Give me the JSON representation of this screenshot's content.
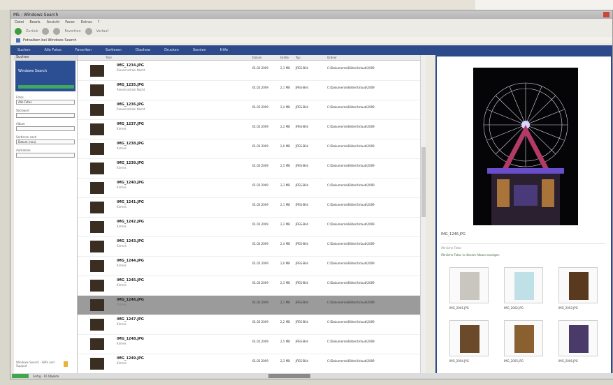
{
  "window": {
    "title": "MS - Windows Search",
    "menu": [
      "Datei",
      "Bearb.",
      "Ansicht",
      "Favor.",
      "Extras",
      "?"
    ],
    "nav": [
      "Zurück",
      "Favoriten",
      "Verlauf"
    ],
    "address": "Fotoalben bei Windows Search"
  },
  "topnav": [
    "Suchen",
    "Alle Fotos",
    "Favoriten",
    "Sortieren",
    "Diashow",
    "Drucken",
    "Senden",
    "Hilfe"
  ],
  "left_panel": {
    "header": "Suchen",
    "logo": "Windows Search",
    "fields": [
      {
        "label": "Fotos",
        "value": "Alle Fotos"
      },
      {
        "label": "Stichwort",
        "value": ""
      },
      {
        "label": "Album",
        "value": ""
      },
      {
        "label": "Sortieren nach",
        "value": "Datum (neu)"
      },
      {
        "label": "Aufnahme",
        "value": ""
      }
    ],
    "footer": "Windows Search - Hilfe und Support"
  },
  "list": {
    "headers": [
      "Titel",
      "Datum",
      "Größe",
      "Typ",
      "Ordner"
    ],
    "rows": [
      {
        "title": "IMG_1234.JPG",
        "sub": "Riesenrad bei Nacht",
        "date": "01.02.2009",
        "size": "2,3 MB",
        "type": "JPEG-Bild",
        "path": "C:\\Dokumente\\Bilder\\Urlaub\\2009"
      },
      {
        "title": "IMG_1235.JPG",
        "sub": "Riesenrad bei Nacht",
        "date": "01.02.2009",
        "size": "2,1 MB",
        "type": "JPEG-Bild",
        "path": "C:\\Dokumente\\Bilder\\Urlaub\\2009"
      },
      {
        "title": "IMG_1236.JPG",
        "sub": "Riesenrad bei Nacht",
        "date": "01.02.2009",
        "size": "2,4 MB",
        "type": "JPEG-Bild",
        "path": "C:\\Dokumente\\Bilder\\Urlaub\\2009"
      },
      {
        "title": "IMG_1237.JPG",
        "sub": "Kirmes",
        "date": "01.02.2009",
        "size": "2,2 MB",
        "type": "JPEG-Bild",
        "path": "C:\\Dokumente\\Bilder\\Urlaub\\2009"
      },
      {
        "title": "IMG_1238.JPG",
        "sub": "Kirmes",
        "date": "01.02.2009",
        "size": "2,0 MB",
        "type": "JPEG-Bild",
        "path": "C:\\Dokumente\\Bilder\\Urlaub\\2009"
      },
      {
        "title": "IMG_1239.JPG",
        "sub": "Kirmes",
        "date": "01.02.2009",
        "size": "2,5 MB",
        "type": "JPEG-Bild",
        "path": "C:\\Dokumente\\Bilder\\Urlaub\\2009"
      },
      {
        "title": "IMG_1240.JPG",
        "sub": "Kirmes",
        "date": "01.02.2009",
        "size": "2,3 MB",
        "type": "JPEG-Bild",
        "path": "C:\\Dokumente\\Bilder\\Urlaub\\2009"
      },
      {
        "title": "IMG_1241.JPG",
        "sub": "Kirmes",
        "date": "01.02.2009",
        "size": "2,1 MB",
        "type": "JPEG-Bild",
        "path": "C:\\Dokumente\\Bilder\\Urlaub\\2009"
      },
      {
        "title": "IMG_1242.JPG",
        "sub": "Kirmes",
        "date": "01.02.2009",
        "size": "2,2 MB",
        "type": "JPEG-Bild",
        "path": "C:\\Dokumente\\Bilder\\Urlaub\\2009"
      },
      {
        "title": "IMG_1243.JPG",
        "sub": "Kirmes",
        "date": "01.02.2009",
        "size": "2,4 MB",
        "type": "JPEG-Bild",
        "path": "C:\\Dokumente\\Bilder\\Urlaub\\2009"
      },
      {
        "title": "IMG_1244.JPG",
        "sub": "Kirmes",
        "date": "01.02.2009",
        "size": "2,0 MB",
        "type": "JPEG-Bild",
        "path": "C:\\Dokumente\\Bilder\\Urlaub\\2009"
      },
      {
        "title": "IMG_1245.JPG",
        "sub": "Kirmes",
        "date": "01.02.2009",
        "size": "2,3 MB",
        "type": "JPEG-Bild",
        "path": "C:\\Dokumente\\Bilder\\Urlaub\\2009"
      },
      {
        "title": "IMG_1246.JPG",
        "sub": "Kirmes",
        "date": "01.02.2009",
        "size": "2,1 MB",
        "type": "JPEG-Bild",
        "path": "C:\\Dokumente\\Bilder\\Urlaub\\2009",
        "selected": true
      },
      {
        "title": "IMG_1247.JPG",
        "sub": "Kirmes",
        "date": "01.02.2009",
        "size": "2,2 MB",
        "type": "JPEG-Bild",
        "path": "C:\\Dokumente\\Bilder\\Urlaub\\2009"
      },
      {
        "title": "IMG_1248.JPG",
        "sub": "Kirmes",
        "date": "01.02.2009",
        "size": "2,5 MB",
        "type": "JPEG-Bild",
        "path": "C:\\Dokumente\\Bilder\\Urlaub\\2009"
      },
      {
        "title": "IMG_1249.JPG",
        "sub": "Kirmes",
        "date": "01.02.2009",
        "size": "2,3 MB",
        "type": "JPEG-Bild",
        "path": "C:\\Dokumente\\Bilder\\Urlaub\\2009"
      }
    ]
  },
  "preview": {
    "title": "IMG_1246.JPG",
    "sub1": "Ähnliche Fotos",
    "sub2": "Ähnliche Fotos in diesem Album anzeigen",
    "tiles": [
      {
        "caption": "IMG_2001.JPG",
        "color": "#c9c5bf"
      },
      {
        "caption": "IMG_2002.JPG",
        "color": "#bfe0e6"
      },
      {
        "caption": "IMG_2003.JPG",
        "color": "#5a3a1e"
      },
      {
        "caption": "IMG_2004.JPG",
        "color": "#6a4a28"
      },
      {
        "caption": "IMG_2005.JPG",
        "color": "#8a6030"
      },
      {
        "caption": "IMG_2006.JPG",
        "color": "#4a3a6a"
      }
    ]
  },
  "statusbar": "Fertig - 16 Objekte"
}
